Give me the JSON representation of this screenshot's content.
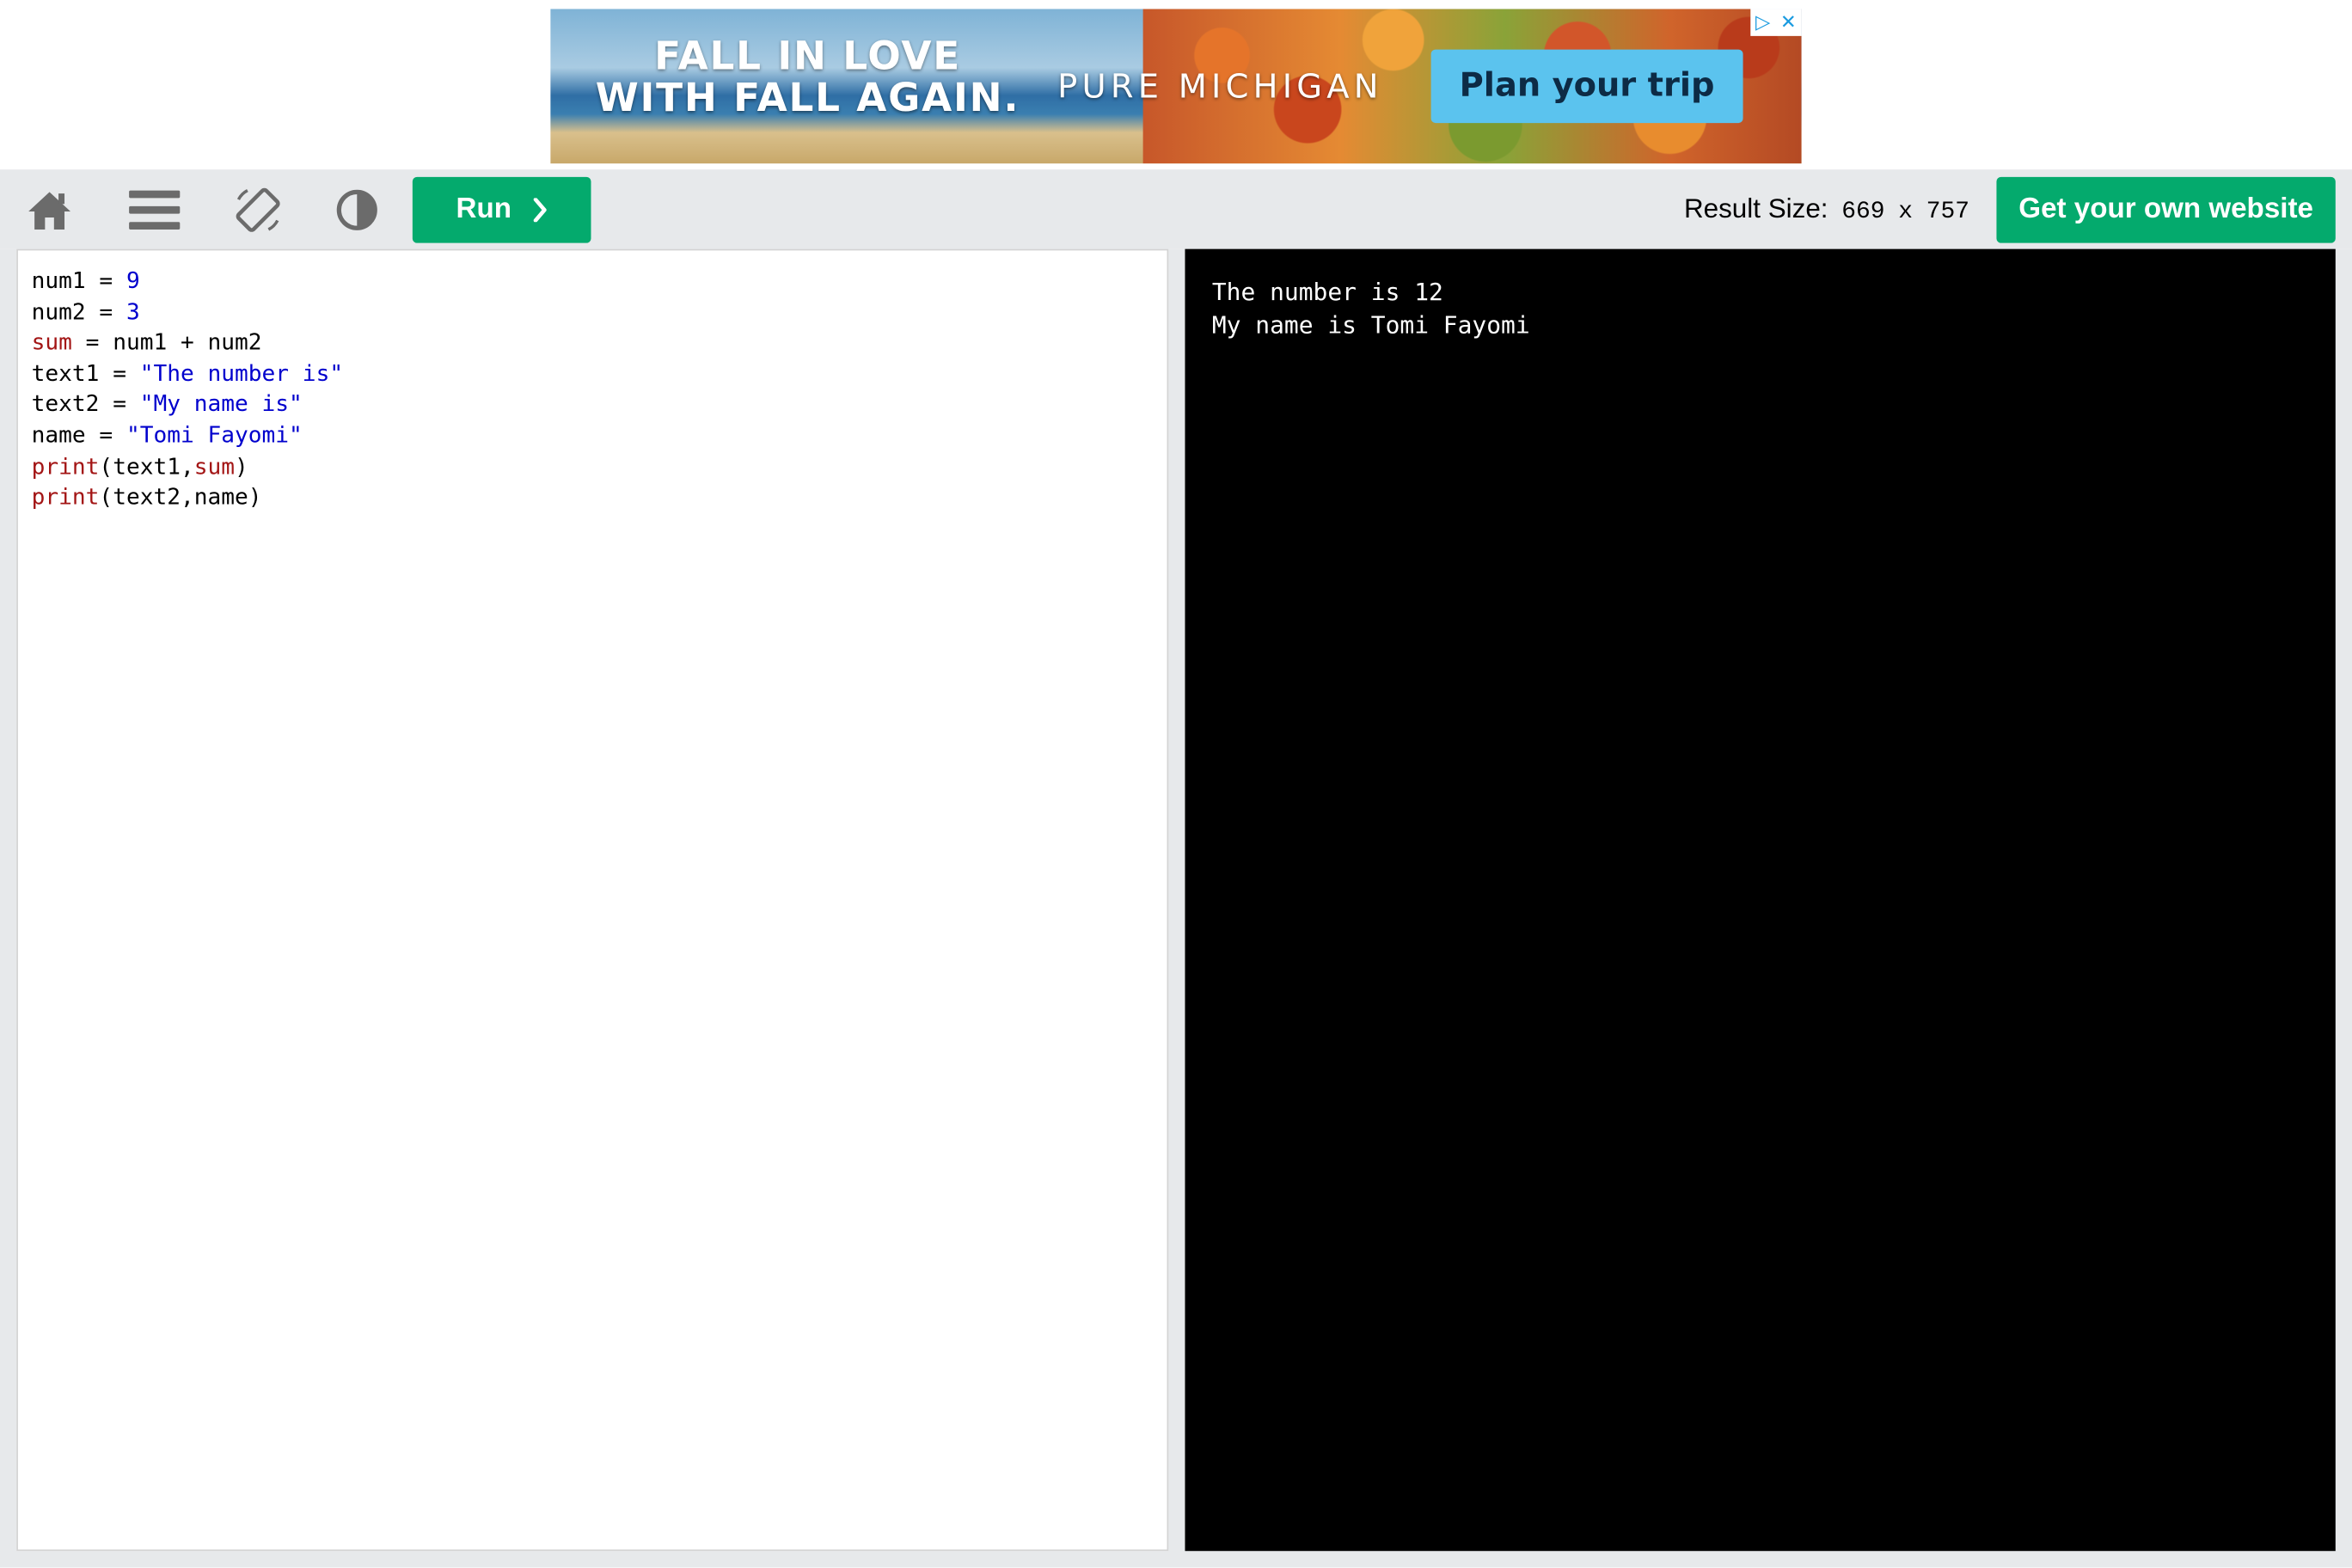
{
  "ad": {
    "headline_line1": "FALL IN LOVE",
    "headline_line2": "WITH FALL AGAIN.",
    "brand": "PURE MICHIGAN",
    "cta": "Plan your trip",
    "adchoices_play": "▷",
    "adchoices_close": "✕"
  },
  "toolbar": {
    "run_label": "Run",
    "result_size_label": "Result Size:",
    "result_width": "669",
    "result_x": "x",
    "result_height": "757",
    "own_site_label": "Get your own website"
  },
  "editor": {
    "lines": [
      [
        {
          "t": "num1 = ",
          "c": ""
        },
        {
          "t": "9",
          "c": "num"
        }
      ],
      [
        {
          "t": "num2 = ",
          "c": ""
        },
        {
          "t": "3",
          "c": "num"
        }
      ],
      [
        {
          "t": "sum",
          "c": "kw"
        },
        {
          "t": " = num1 + num2",
          "c": ""
        }
      ],
      [
        {
          "t": "text1 = ",
          "c": ""
        },
        {
          "t": "\"The number is\"",
          "c": "str"
        }
      ],
      [
        {
          "t": "text2 = ",
          "c": ""
        },
        {
          "t": "\"My name is\"",
          "c": "str"
        }
      ],
      [
        {
          "t": "name = ",
          "c": ""
        },
        {
          "t": "\"Tomi Fayomi\"",
          "c": "str"
        }
      ],
      [
        {
          "t": "print",
          "c": "kw"
        },
        {
          "t": "(text1,",
          "c": ""
        },
        {
          "t": "sum",
          "c": "kw"
        },
        {
          "t": ")",
          "c": ""
        }
      ],
      [
        {
          "t": "print",
          "c": "kw"
        },
        {
          "t": "(text2,name)",
          "c": ""
        }
      ]
    ]
  },
  "output": {
    "lines": [
      "The number is 12",
      "My name is Tomi Fayomi"
    ]
  },
  "colors": {
    "accent_green": "#04aa6d",
    "toolbar_bg": "#e7e9eb",
    "keyword": "#a31515",
    "string": "#0000cd"
  },
  "icons": [
    "home-icon",
    "menu-icon",
    "rotate-icon",
    "contrast-icon",
    "chevron-right-icon"
  ]
}
